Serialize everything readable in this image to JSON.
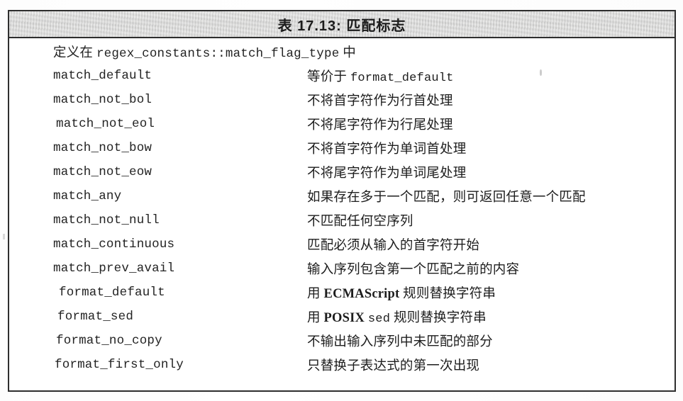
{
  "figure": {
    "title": "表 17.13: 匹配标志",
    "border_color": "#2e2e2e",
    "header_fill": "#d8d8d8"
  },
  "table": {
    "intro": {
      "prefix_cn": "定义在 ",
      "code": "regex_constants::match_flag_type",
      "suffix_cn": " 中"
    },
    "rows": [
      {
        "term": "match_default",
        "desc_plain": "等价于 format_default",
        "desc_cn": "等价于 ",
        "desc_code": "format_default",
        "desc_tail": ""
      },
      {
        "term": "match_not_bol",
        "desc_plain": "不将首字符作为行首处理",
        "desc_cn": "不将首字符作为行首处理",
        "desc_code": "",
        "desc_tail": ""
      },
      {
        "term": "match_not_eol",
        "desc_plain": "不将尾字符作为行尾处理",
        "desc_cn": "不将尾字符作为行尾处理",
        "desc_code": "",
        "desc_tail": ""
      },
      {
        "term": "match_not_bow",
        "desc_plain": "不将首字符作为单词首处理",
        "desc_cn": "不将首字符作为单词首处理",
        "desc_code": "",
        "desc_tail": ""
      },
      {
        "term": "match_not_eow",
        "desc_plain": "不将尾字符作为单词尾处理",
        "desc_cn": "不将尾字符作为单词尾处理",
        "desc_code": "",
        "desc_tail": ""
      },
      {
        "term": "match_any",
        "desc_plain": "如果存在多于一个匹配，则可返回任意一个匹配",
        "desc_cn": "如果存在多于一个匹配，则可返回任意一个匹配",
        "desc_code": "",
        "desc_tail": ""
      },
      {
        "term": "match_not_null",
        "desc_plain": "不匹配任何空序列",
        "desc_cn": "不匹配任何空序列",
        "desc_code": "",
        "desc_tail": ""
      },
      {
        "term": "match_continuous",
        "desc_plain": "匹配必须从输入的首字符开始",
        "desc_cn": "匹配必须从输入的首字符开始",
        "desc_code": "",
        "desc_tail": ""
      },
      {
        "term": "match_prev_avail",
        "desc_plain": "输入序列包含第一个匹配之前的内容",
        "desc_cn": "输入序列包含第一个匹配之前的内容",
        "desc_code": "",
        "desc_tail": ""
      },
      {
        "term": "format_default",
        "desc_plain": "用 ECMAScript 规则替换字符串",
        "desc_cn": "用 ",
        "desc_code": "ECMAScript",
        "desc_tail": " 规则替换字符串"
      },
      {
        "term": "format_sed",
        "desc_plain": "用 POSIX sed 规则替换字符串",
        "desc_cn": "用 ",
        "desc_code": "POSIX",
        "desc_tail": " 规则替换字符串"
      },
      {
        "term": "format_no_copy",
        "desc_plain": "不输出输入序列中未匹配的部分",
        "desc_cn": "不输出输入序列中未匹配的部分",
        "desc_code": "",
        "desc_tail": ""
      },
      {
        "term": "format_first_only",
        "desc_plain": "只替换子表达式的第一次出现",
        "desc_cn": "只替换子表达式的第一次出现",
        "desc_code": "",
        "desc_tail": ""
      }
    ],
    "sed_keyword": "sed"
  }
}
